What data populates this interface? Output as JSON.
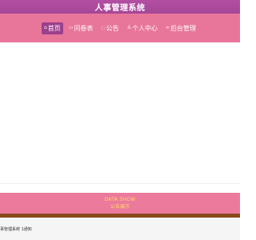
{
  "header": {
    "title": "人事管理系统"
  },
  "nav": {
    "items": [
      {
        "icon": "home-icon",
        "glyph": "⌂",
        "label": "首页",
        "active": true
      },
      {
        "icon": "survey-icon",
        "glyph": "▭",
        "label": "问卷表",
        "active": false
      },
      {
        "icon": "notice-icon",
        "glyph": "◌",
        "label": "公告",
        "active": false
      },
      {
        "icon": "user-icon",
        "glyph": "♙",
        "label": "个人中心",
        "active": false
      },
      {
        "icon": "link-icon",
        "glyph": "∞",
        "label": "后台管理",
        "active": false
      }
    ]
  },
  "notice": {
    "title_en": "DATA SHOW",
    "title_cn": "公告展示"
  },
  "footer": {
    "text": "事管理系统 1通知"
  },
  "colors": {
    "topbar": "#a54696",
    "nav": "#e8769a",
    "active": "#9c3f8c",
    "notice": "#ec7a9d",
    "notice_text": "#ffd966",
    "brownbar": "#8a4a1c"
  }
}
